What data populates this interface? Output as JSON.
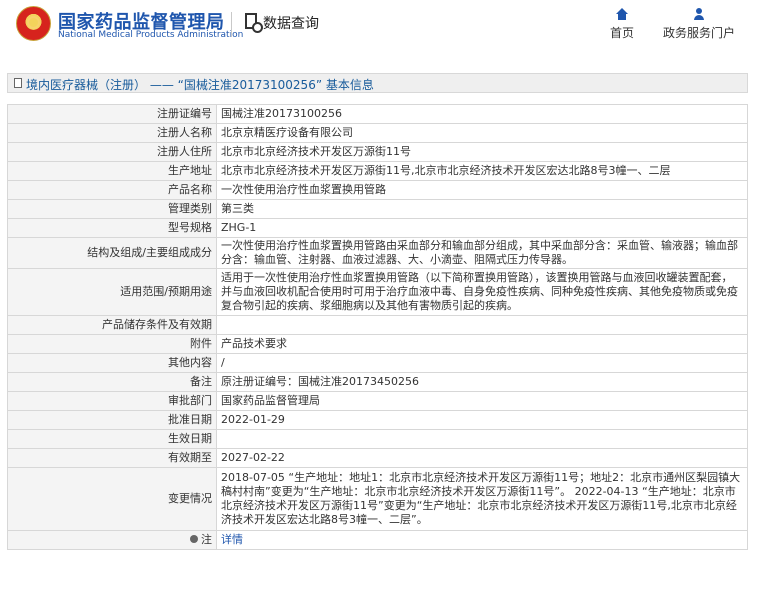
{
  "header": {
    "site_title_cn": "国家药品监督管理局",
    "site_title_en": "National Medical Products Administration",
    "section_title": "数据查询",
    "nav": [
      {
        "label": "首页"
      },
      {
        "label": "政务服务门户"
      }
    ]
  },
  "breadcrumb": {
    "text": "境内医疗器械（注册） —— “国械注准20173100256” 基本信息"
  },
  "details": {
    "rows": [
      {
        "label": "注册证编号",
        "value": "国械注准20173100256"
      },
      {
        "label": "注册人名称",
        "value": "北京京精医疗设备有限公司"
      },
      {
        "label": "注册人住所",
        "value": "北京市北京经济技术开发区万源街11号"
      },
      {
        "label": "生产地址",
        "value": "北京市北京经济技术开发区万源街11号,北京市北京经济技术开发区宏达北路8号3幢一、二层"
      },
      {
        "label": "产品名称",
        "value": "一次性使用治疗性血浆置换用管路"
      },
      {
        "label": "管理类别",
        "value": "第三类"
      },
      {
        "label": "型号规格",
        "value": "ZHG-1"
      },
      {
        "label": "结构及组成/主要组成成分",
        "value": "一次性使用治疗性血浆置换用管路由采血部分和输血部分组成，其中采血部分含：采血管、输液器；输血部分含：输血管、注射器、血液过滤器、大、小滴壶、阻隔式压力传导器。"
      },
      {
        "label": "适用范围/预期用途",
        "value": "适用于一次性使用治疗性血浆置换用管路（以下简称置换用管路），该置换用管路与血液回收罐装置配套，并与血液回收机配合使用时可用于治疗血液中毒、自身免疫性疾病、同种免疫性疾病、其他免疫物质或免疫复合物引起的疾病、浆细胞病以及其他有害物质引起的疾病。"
      },
      {
        "label": "产品储存条件及有效期",
        "value": ""
      },
      {
        "label": "附件",
        "value": "产品技术要求"
      },
      {
        "label": "其他内容",
        "value": "/"
      },
      {
        "label": "备注",
        "value": "原注册证编号：国械注准20173450256"
      },
      {
        "label": "审批部门",
        "value": "国家药品监督管理局"
      },
      {
        "label": "批准日期",
        "value": "2022-01-29"
      },
      {
        "label": "生效日期",
        "value": ""
      },
      {
        "label": "有效期至",
        "value": "2027-02-22"
      },
      {
        "label": "变更情况",
        "value": "2018-07-05 “生产地址：地址1：北京市北京经济技术开发区万源街11号；地址2：北京市通州区梨园镇大稿村村南”变更为“生产地址：北京市北京经济技术开发区万源街11号”。\n2022-04-13 “生产地址：北京市北京经济技术开发区万源街11号”变更为“生产地址：北京市北京经济技术开发区万源街11号,北京市北京经济技术开发区宏达北路8号3幢一、二层”。"
      },
      {
        "label": "注",
        "value": "详情"
      }
    ]
  },
  "icons": {
    "home": "home-icon",
    "user": "user-icon",
    "query": "search-document-icon",
    "note": "lightbulb-icon"
  },
  "colors": {
    "brand": "#1f56ad",
    "label_bg": "#f4f4f4",
    "border": "#d7d7d7"
  }
}
